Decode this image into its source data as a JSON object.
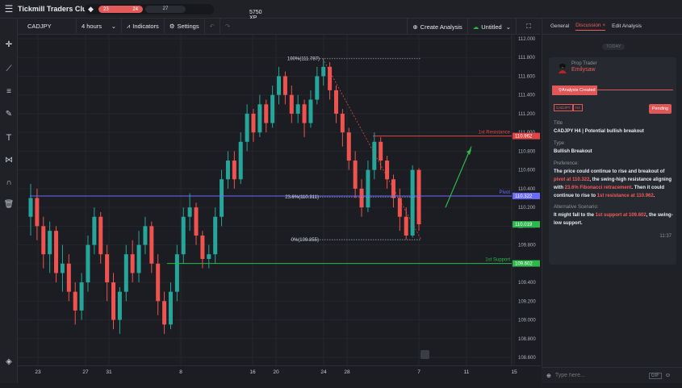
{
  "app": {
    "title": "Tickmill Traders Club",
    "level_left": "23",
    "level_right": "24",
    "xp_progress": 0.78,
    "badge_level": "27",
    "xp": "5750 XP"
  },
  "toolbar": {
    "symbol": "CADJPY",
    "interval": "4 hours",
    "indicators": "Indicators",
    "settings": "Settings",
    "create_analysis": "Create Analysis",
    "layout_name": "Untitled"
  },
  "chart_data": {
    "type": "candlestick",
    "symbol": "CADJPY",
    "ylim": [
      108.6,
      112.0
    ],
    "y_ticks": [
      "112.000",
      "111.800",
      "111.600",
      "111.400",
      "111.200",
      "111.000",
      "110.800",
      "110.600",
      "110.400",
      "110.200",
      "110.000",
      "109.800",
      "109.600",
      "109.400",
      "109.200",
      "109.000",
      "108.800",
      "108.600"
    ],
    "x_ticks": [
      "23",
      "27",
      "31",
      "8",
      "16",
      "20",
      "24",
      "28",
      "7",
      "11",
      "15"
    ],
    "levels": [
      {
        "name": "1st Resistance",
        "value": 110.962,
        "value_label": "110.962",
        "color": "#e04444"
      },
      {
        "name": "Pivot",
        "value": 110.322,
        "value_label": "110.322",
        "color": "#6b6bff"
      },
      {
        "name": "1st Support",
        "value": 109.602,
        "value_label": "109.602",
        "color": "#2db84a"
      }
    ],
    "last_price": {
      "value": 110.019,
      "label": "110.019",
      "color": "#2db84a"
    },
    "fibonacci": [
      {
        "label": "100%(111.787)",
        "value": 111.787
      },
      {
        "label": "23.6%(110.311)",
        "value": 110.311
      },
      {
        "label": "0%(109.855)",
        "value": 109.855
      }
    ],
    "candles": [
      [
        110.1,
        110.3,
        110.45,
        109.9
      ],
      [
        110.3,
        110.0,
        110.4,
        109.85
      ],
      [
        110.0,
        109.7,
        110.1,
        109.55
      ],
      [
        109.7,
        109.95,
        110.05,
        109.5
      ],
      [
        109.95,
        109.5,
        110.0,
        109.4
      ],
      [
        109.5,
        109.6,
        109.8,
        109.3
      ],
      [
        109.6,
        109.3,
        109.7,
        109.2
      ],
      [
        109.3,
        109.1,
        109.4,
        108.95
      ],
      [
        109.1,
        109.4,
        109.5,
        109.0
      ],
      [
        109.4,
        109.8,
        109.9,
        109.3
      ],
      [
        109.8,
        110.1,
        110.2,
        109.7
      ],
      [
        110.1,
        109.7,
        110.15,
        109.6
      ],
      [
        109.7,
        109.4,
        109.8,
        109.2
      ],
      [
        109.4,
        109.0,
        109.5,
        108.9
      ],
      [
        109.0,
        109.3,
        109.35,
        108.85
      ],
      [
        109.3,
        109.7,
        109.8,
        109.2
      ],
      [
        109.7,
        109.5,
        109.85,
        109.4
      ],
      [
        109.5,
        109.8,
        109.95,
        109.4
      ],
      [
        109.8,
        110.0,
        110.1,
        109.7
      ],
      [
        110.0,
        109.6,
        110.05,
        109.5
      ],
      [
        109.6,
        109.2,
        109.7,
        109.05
      ],
      [
        109.2,
        108.95,
        109.3,
        108.85
      ],
      [
        108.95,
        109.3,
        109.4,
        108.9
      ],
      [
        109.3,
        109.7,
        109.8,
        109.2
      ],
      [
        109.7,
        110.1,
        110.2,
        109.6
      ],
      [
        110.1,
        110.2,
        110.35,
        109.95
      ],
      [
        110.2,
        109.9,
        110.25,
        109.8
      ],
      [
        109.9,
        109.65,
        109.95,
        109.55
      ],
      [
        109.65,
        109.7,
        109.8,
        109.55
      ],
      [
        109.7,
        110.1,
        110.2,
        109.6
      ],
      [
        110.1,
        110.5,
        110.6,
        110.0
      ],
      [
        110.5,
        110.7,
        110.8,
        110.4
      ],
      [
        110.7,
        110.5,
        110.8,
        110.4
      ],
      [
        110.5,
        110.9,
        111.0,
        110.45
      ],
      [
        110.9,
        111.2,
        111.3,
        110.8
      ],
      [
        111.2,
        111.0,
        111.25,
        110.9
      ],
      [
        111.0,
        111.3,
        111.4,
        110.95
      ],
      [
        111.3,
        111.1,
        111.35,
        111.0
      ],
      [
        111.1,
        111.4,
        111.5,
        111.05
      ],
      [
        111.4,
        111.6,
        111.7,
        111.3
      ],
      [
        111.6,
        111.4,
        111.65,
        111.3
      ],
      [
        111.4,
        111.2,
        111.5,
        111.1
      ],
      [
        111.2,
        111.3,
        111.4,
        111.1
      ],
      [
        111.3,
        111.1,
        111.35,
        110.95
      ],
      [
        111.1,
        111.35,
        111.45,
        111.05
      ],
      [
        111.35,
        111.6,
        111.7,
        111.3
      ],
      [
        111.6,
        111.7,
        111.79,
        111.5
      ],
      [
        111.7,
        111.45,
        111.75,
        111.35
      ],
      [
        111.45,
        111.2,
        111.5,
        111.1
      ],
      [
        111.2,
        111.0,
        111.25,
        110.85
      ],
      [
        111.0,
        110.7,
        111.05,
        110.6
      ],
      [
        110.7,
        110.4,
        110.8,
        110.3
      ],
      [
        110.4,
        110.2,
        110.5,
        110.1
      ],
      [
        110.2,
        110.6,
        110.7,
        110.15
      ],
      [
        110.6,
        110.9,
        111.0,
        110.5
      ],
      [
        110.9,
        110.7,
        110.95,
        110.6
      ],
      [
        110.7,
        110.5,
        110.75,
        110.4
      ],
      [
        110.5,
        110.3,
        110.55,
        110.2
      ],
      [
        110.3,
        110.1,
        110.4,
        109.95
      ],
      [
        110.1,
        109.9,
        110.2,
        109.86
      ],
      [
        109.9,
        110.6,
        110.65,
        109.88
      ],
      [
        110.6,
        110.02,
        110.62,
        109.95
      ]
    ]
  },
  "panel": {
    "tabs": [
      "General",
      "Discussion",
      "Edit Analysis"
    ],
    "active_tab": 1,
    "today": "TODAY",
    "role": "Prop Trader",
    "user": "Emilysaw",
    "status_chip": "Analysis Created",
    "tags": [
      "CADJPY",
      "H4"
    ],
    "pending": "Pending",
    "title_label": "Title",
    "title_value": "CADJPY H4 | Potential bullish breakout",
    "type_label": "Type",
    "type_value": "Bullish Breakout",
    "pref_label": "Preference:",
    "pref_parts": [
      "The price could continue to rise and breakout of ",
      "pivot at 110.322",
      ", the swing-high resistance aligning with ",
      "23.6% Fibonacci retracement",
      ". Then it could continue to rise to ",
      "1st resistance at 110.962",
      "."
    ],
    "alt_label": "Alternative Scenario:",
    "alt_parts": [
      "It might fall to the ",
      "1st support at 109.602",
      ", the swing-low support."
    ],
    "time": "11:37",
    "composer_placeholder": "Type here...",
    "gif": "GIF"
  }
}
